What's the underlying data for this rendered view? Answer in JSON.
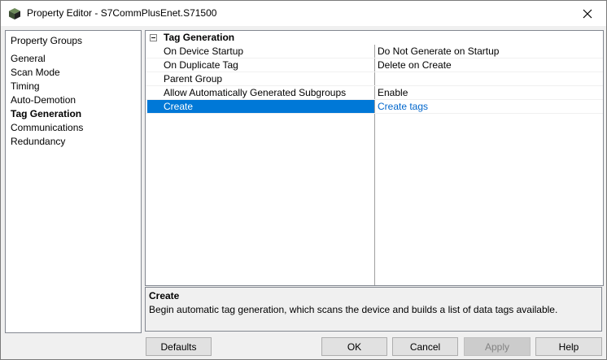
{
  "window": {
    "title": "Property Editor - S7CommPlusEnet.S71500"
  },
  "groups": {
    "header": "Property Groups",
    "items": [
      {
        "label": "General"
      },
      {
        "label": "Scan Mode"
      },
      {
        "label": "Timing"
      },
      {
        "label": "Auto-Demotion"
      },
      {
        "label": "Tag Generation",
        "active": true
      },
      {
        "label": "Communications"
      },
      {
        "label": "Redundancy"
      }
    ]
  },
  "properties": {
    "section_title": "Tag Generation",
    "rows": [
      {
        "name": "On Device Startup",
        "value": "Do Not Generate on Startup"
      },
      {
        "name": "On Duplicate Tag",
        "value": "Delete on Create"
      },
      {
        "name": "Parent Group",
        "value": ""
      },
      {
        "name": "Allow Automatically Generated Subgroups",
        "value": "Enable"
      },
      {
        "name": "Create",
        "value": "Create tags",
        "selected": true
      }
    ]
  },
  "description": {
    "title": "Create",
    "text": "Begin automatic tag generation, which scans the device and builds a list of data tags available."
  },
  "buttons": {
    "defaults": "Defaults",
    "ok": "OK",
    "cancel": "Cancel",
    "apply": "Apply",
    "help": "Help"
  },
  "icons": {
    "app": "property-editor-cube-icon",
    "close": "close-icon",
    "collapse": "collapse-minus-icon"
  },
  "colors": {
    "selection": "#0078d7",
    "link": "#0066cc"
  }
}
